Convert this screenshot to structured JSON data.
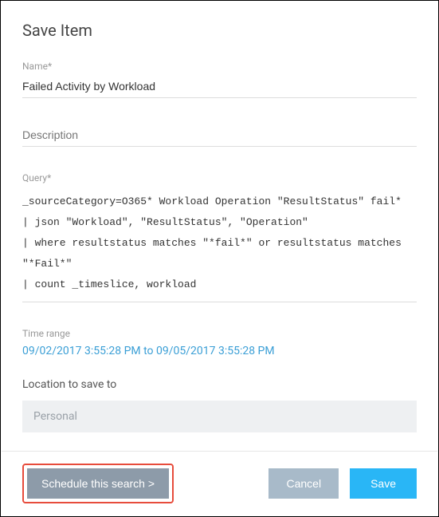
{
  "dialog": {
    "title": "Save Item"
  },
  "name": {
    "label": "Name*",
    "value": "Failed Activity by Workload"
  },
  "description": {
    "placeholder": "Description",
    "value": ""
  },
  "query": {
    "label": "Query*",
    "value": "_sourceCategory=O365* Workload Operation \"ResultStatus\" fail*\n| json \"Workload\", \"ResultStatus\", \"Operation\"\n| where resultstatus matches \"*fail*\" or resultstatus matches \"*Fail*\"\n| count _timeslice, workload"
  },
  "timerange": {
    "label": "Time range",
    "value": "09/02/2017 3:55:28 PM to 09/05/2017 3:55:28 PM"
  },
  "location": {
    "label": "Location to save to",
    "value": "Personal"
  },
  "footer": {
    "schedule": "Schedule this search >",
    "cancel": "Cancel",
    "save": "Save"
  }
}
